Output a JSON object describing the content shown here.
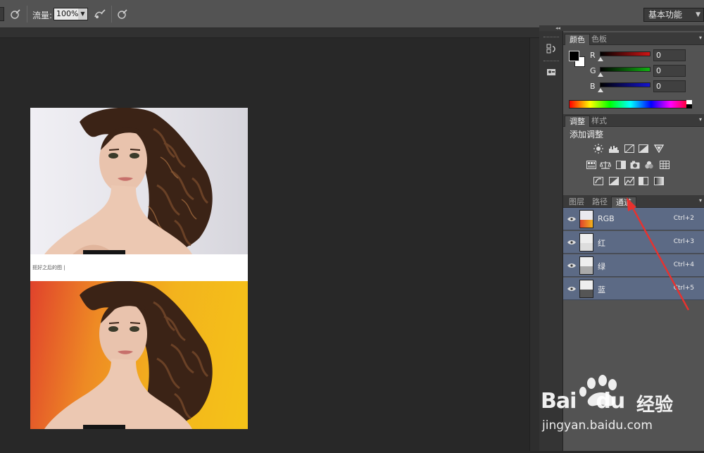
{
  "options_bar": {
    "flow_label": "流量:",
    "flow_value": "100%",
    "workspace": "基本功能"
  },
  "document": {
    "caption": "抠好之后的图 |"
  },
  "color_panel": {
    "tabs": [
      "颜色",
      "色板"
    ],
    "channels": [
      {
        "label": "R",
        "value": "0",
        "color": "#d01414"
      },
      {
        "label": "G",
        "value": "0",
        "color": "#12b012"
      },
      {
        "label": "B",
        "value": "0",
        "color": "#1414d0"
      }
    ]
  },
  "adjust_panel": {
    "tabs": [
      "调整",
      "样式"
    ],
    "heading": "添加调整"
  },
  "layers_panel": {
    "tabs": [
      "图层",
      "路径",
      "通道"
    ],
    "channels": [
      {
        "name": "RGB",
        "shortcut": "Ctrl+2"
      },
      {
        "name": "红",
        "shortcut": "Ctrl+3"
      },
      {
        "name": "绿",
        "shortcut": "Ctrl+4"
      },
      {
        "name": "蓝",
        "shortcut": "Ctrl+5"
      }
    ]
  },
  "watermark": {
    "brand_a": "Bai",
    "brand_b": "du",
    "brand_cn": "经验",
    "url": "jingyan.baidu.com"
  },
  "colors": {
    "highlight_row": "#5c6a85",
    "arrow": "#e8322e"
  }
}
